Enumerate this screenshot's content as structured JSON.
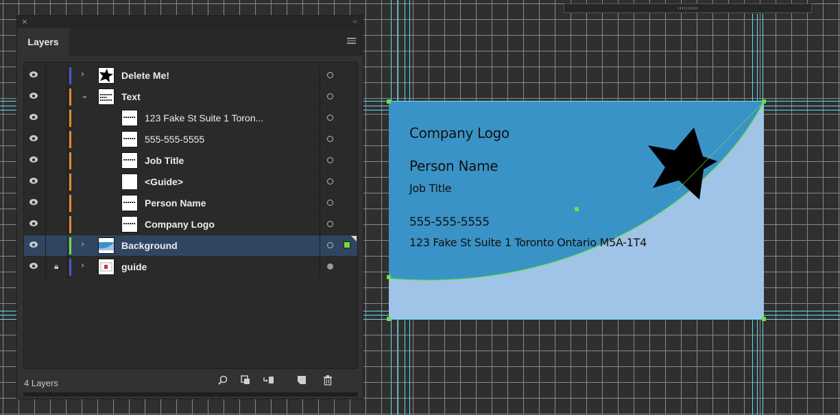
{
  "panel": {
    "tab_label": "Layers",
    "layer_count": "4 Layers",
    "close_glyph": "×",
    "collapse_glyph": "‹‹",
    "layers": [
      {
        "name": "Delete Me!",
        "bold": true,
        "indent": 0,
        "expand": "›",
        "color": "#4b55d8",
        "thumb": "star-thumb",
        "locked": false,
        "selected": false,
        "target": "open"
      },
      {
        "name": "Text",
        "bold": true,
        "indent": 0,
        "expand": "⌄",
        "color": "#e68a2e",
        "thumb": "text-group-thumb",
        "locked": false,
        "selected": false,
        "target": "open"
      },
      {
        "name": "123 Fake St Suite 1 Toron...",
        "bold": false,
        "indent": 1,
        "expand": "",
        "color": "#e68a2e",
        "thumb": "text-thumb",
        "locked": false,
        "selected": false,
        "target": "open"
      },
      {
        "name": "555-555-5555",
        "bold": false,
        "indent": 1,
        "expand": "",
        "color": "#e68a2e",
        "thumb": "text-thumb",
        "locked": false,
        "selected": false,
        "target": "open"
      },
      {
        "name": "Job Title",
        "bold": true,
        "indent": 1,
        "expand": "",
        "color": "#e68a2e",
        "thumb": "text-thumb",
        "locked": false,
        "selected": false,
        "target": "open"
      },
      {
        "name": "<Guide>",
        "bold": true,
        "indent": 1,
        "expand": "",
        "color": "#e68a2e",
        "thumb": "blank-thumb",
        "locked": false,
        "selected": false,
        "target": "open"
      },
      {
        "name": "Person Name",
        "bold": true,
        "indent": 1,
        "expand": "",
        "color": "#e68a2e",
        "thumb": "text-thumb",
        "locked": false,
        "selected": false,
        "target": "open"
      },
      {
        "name": "Company Logo",
        "bold": true,
        "indent": 1,
        "expand": "",
        "color": "#e68a2e",
        "thumb": "text-thumb",
        "locked": false,
        "selected": false,
        "target": "open"
      },
      {
        "name": "Background",
        "bold": true,
        "indent": 0,
        "expand": "›",
        "color": "#6fe23a",
        "thumb": "background-thumb",
        "locked": false,
        "selected": true,
        "target": "open"
      },
      {
        "name": "guide",
        "bold": true,
        "indent": 0,
        "expand": "›",
        "color": "#4b55d8",
        "thumb": "guide-thumb",
        "locked": true,
        "selected": false,
        "target": "filled"
      }
    ],
    "footer_icons": [
      "locate-object-icon",
      "make-clipping-mask-icon",
      "create-sublayer-icon",
      "create-new-layer-icon",
      "delete-layer-icon"
    ]
  },
  "card": {
    "company": "Company Logo",
    "person": "Person Name",
    "job_title": "Job Title",
    "phone": "555-555-5555",
    "address": "123 Fake St Suite 1 Toronto Ontario M5A-1T4",
    "colors": {
      "dark_blue": "#3a93c6",
      "light_blue": "#9fc4e8",
      "guide": "#5fe0ee",
      "anchor": "#6fe23a"
    }
  }
}
